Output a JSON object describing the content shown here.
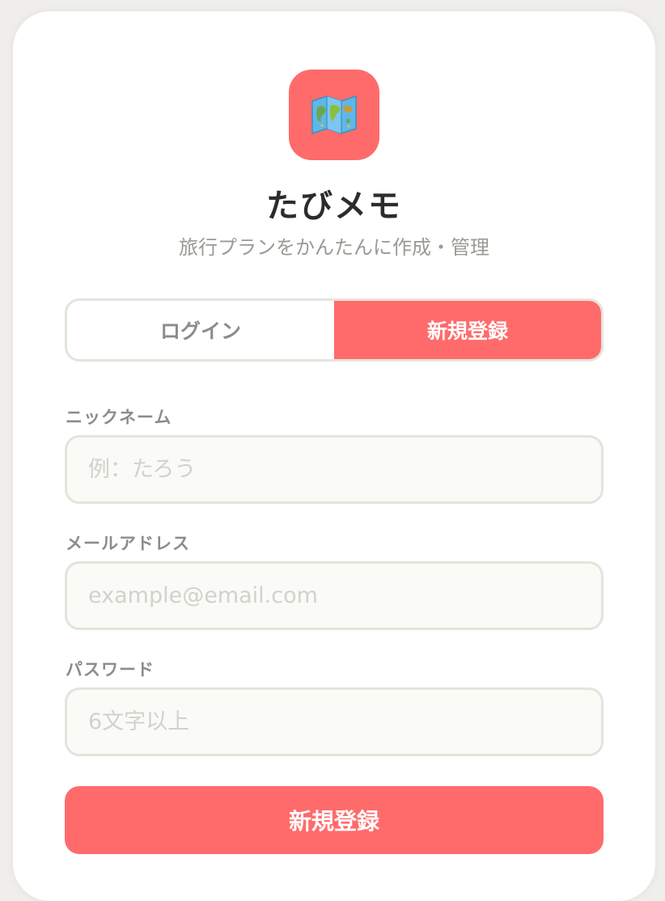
{
  "app": {
    "title": "たびメモ",
    "subtitle": "旅行プランをかんたんに作成・管理",
    "logo_icon": "world-map-icon",
    "accent_color": "#ff6b6b"
  },
  "tabs": {
    "login_label": "ログイン",
    "register_label": "新規登録",
    "active": "register"
  },
  "form": {
    "nickname": {
      "label": "ニックネーム",
      "placeholder": "例：たろう",
      "value": ""
    },
    "email": {
      "label": "メールアドレス",
      "placeholder": "example@email.com",
      "value": ""
    },
    "password": {
      "label": "パスワード",
      "placeholder": "6文字以上",
      "value": ""
    },
    "submit_label": "新規登録"
  }
}
